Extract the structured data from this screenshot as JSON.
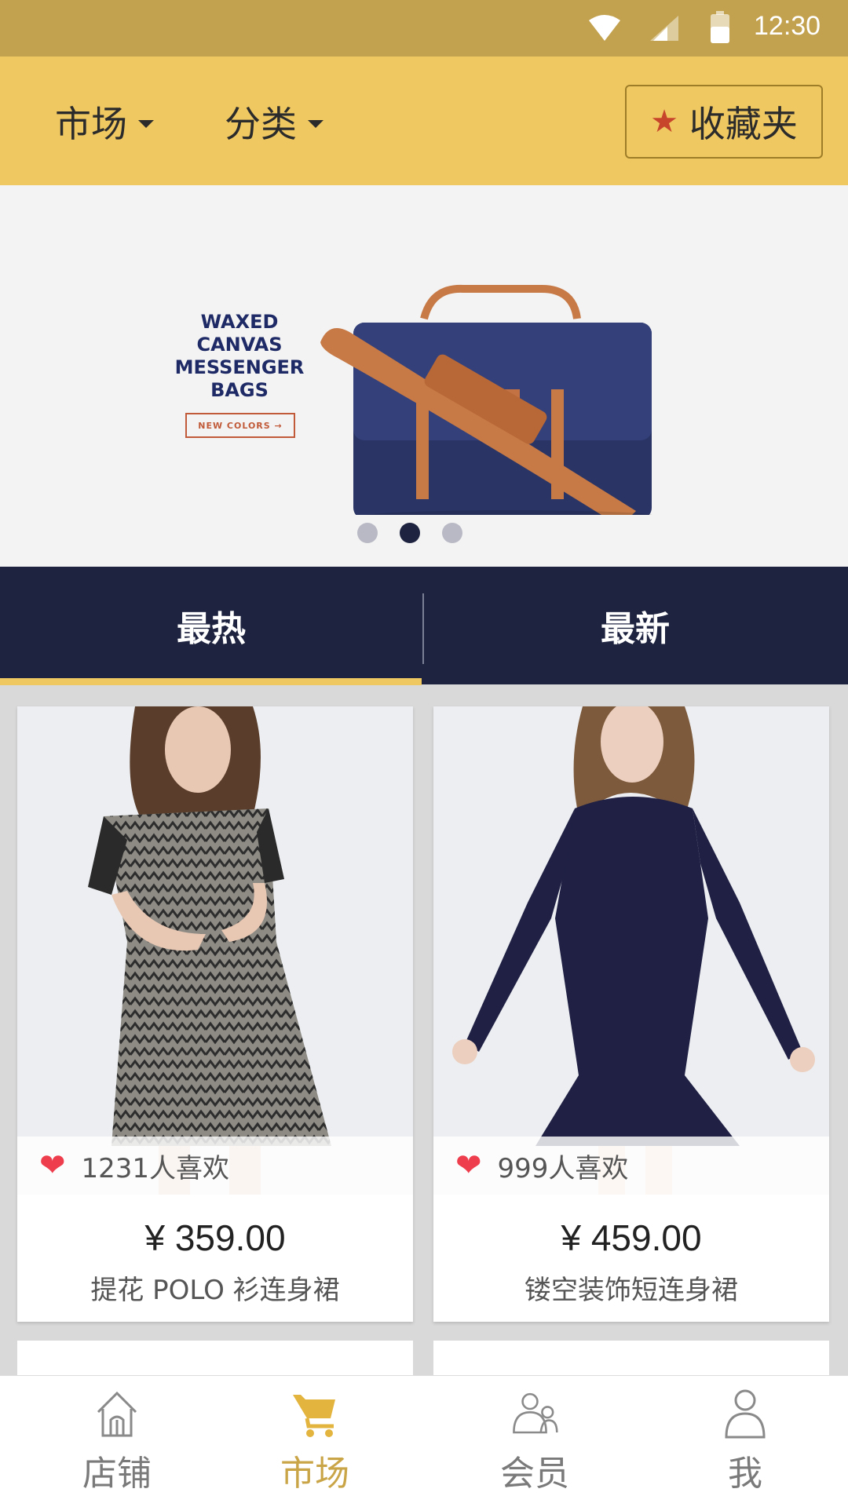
{
  "status_bar": {
    "time": "12:30"
  },
  "header": {
    "market_label": "市场",
    "category_label": "分类",
    "favorites_label": "收藏夹"
  },
  "banner": {
    "line1": "WAXED",
    "line2": "CANVAS",
    "line3": "MESSENGER",
    "line4": "BAGS",
    "cta": "NEW COLORS →",
    "slide_count": 3,
    "active_slide": 2
  },
  "tabs": {
    "hot": "最热",
    "new": "最新",
    "active": "hot"
  },
  "products": [
    {
      "likes": "1231人喜欢",
      "price": "¥ 359.00",
      "name": "提花 POLO 衫连身裙"
    },
    {
      "likes": "999人喜欢",
      "price": "¥ 459.00",
      "name": "镂空装饰短连身裙"
    }
  ],
  "bottom_nav": {
    "shop": "店铺",
    "market": "市场",
    "member": "会员",
    "me": "我",
    "active": "market"
  },
  "colors": {
    "status_bar": "#c2a24f",
    "header": "#f0c862",
    "tab_bar": "#1e2340",
    "accent": "#c9a547",
    "heart": "#ee3d4c"
  }
}
